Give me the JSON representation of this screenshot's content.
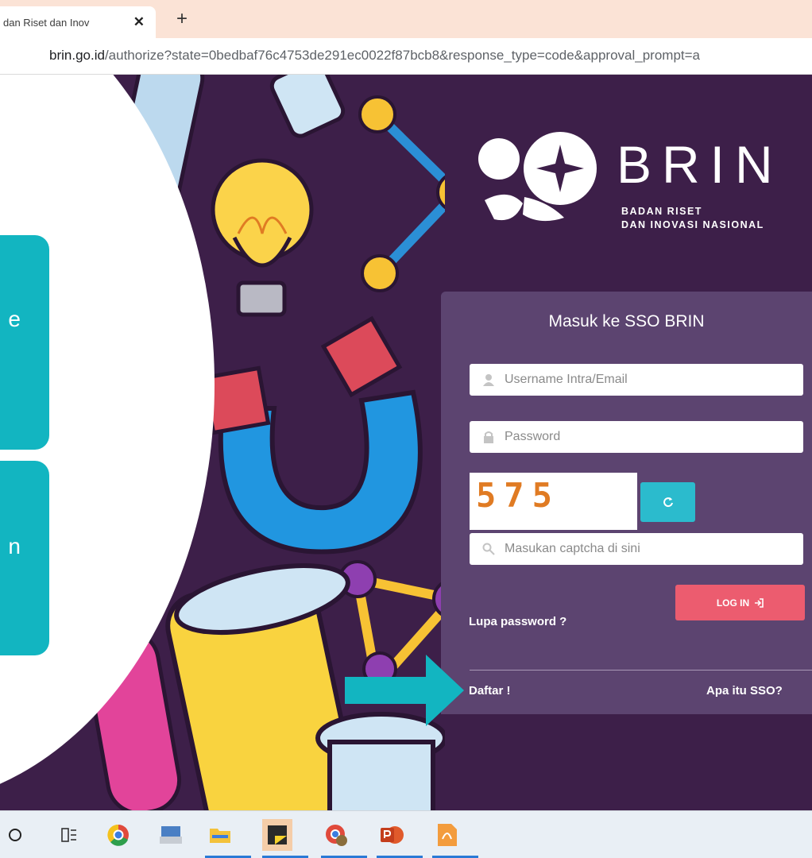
{
  "browser": {
    "tab_title": "dan Riset dan Inov",
    "tab_close": "✕",
    "new_tab": "+",
    "url_host": "brin.go.id",
    "url_path": "/authorize?state=0bedbaf76c4753de291ec0022f87bcb8&response_type=code&approval_prompt=a"
  },
  "brand": {
    "name": "BRIN",
    "sub_line1": "BADAN RISET",
    "sub_line2": "DAN INOVASI NASIONAL"
  },
  "login": {
    "title": "Masuk ke SSO BRIN",
    "username_placeholder": "Username Intra/Email",
    "password_placeholder": "Password",
    "captcha_text": "575",
    "captcha_placeholder": "Masukan captcha di sini",
    "login_label": "LOG IN",
    "forgot_label": "Lupa password ?",
    "register_label": "Daftar !",
    "about_label": "Apa itu SSO?"
  },
  "overlay": {
    "callout_1": "e",
    "callout_2": "n",
    "accent_color": "#12b5c1"
  },
  "taskbar": {
    "items": [
      "search-icon",
      "task-view-icon",
      "chrome-icon",
      "scanner-icon",
      "file-explorer-icon",
      "sticky-notes-icon",
      "chrome-profile-icon",
      "powerpoint-icon",
      "pdf-icon"
    ]
  }
}
